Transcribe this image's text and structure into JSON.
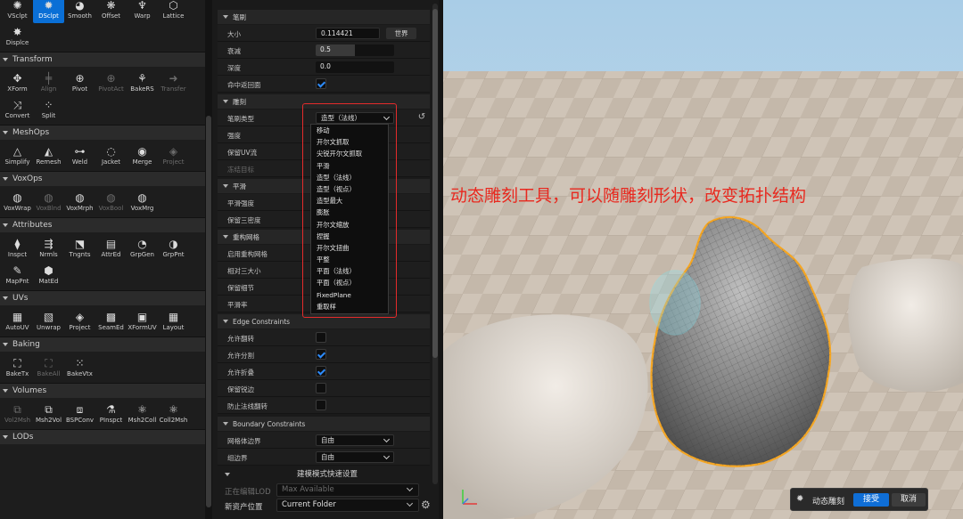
{
  "palette": {
    "sculpt_tools": [
      {
        "label": "VSclpt",
        "icon": "vertex-sculpt-icon"
      },
      {
        "label": "DSclpt",
        "icon": "dynamic-sculpt-icon",
        "active": true
      },
      {
        "label": "Smooth",
        "icon": "smooth-icon"
      },
      {
        "label": "Offset",
        "icon": "offset-icon"
      },
      {
        "label": "Warp",
        "icon": "warp-icon"
      },
      {
        "label": "Lattice",
        "icon": "lattice-icon"
      },
      {
        "label": "Displce",
        "icon": "displace-icon"
      }
    ],
    "categories": [
      {
        "name": "Transform",
        "tools": [
          {
            "label": "XForm"
          },
          {
            "label": "Align",
            "dim": true
          },
          {
            "label": "Pivot"
          },
          {
            "label": "PivotAct",
            "dim": true
          },
          {
            "label": "BakeRS"
          },
          {
            "label": "Transfer",
            "dim": true
          },
          {
            "label": "Convert"
          },
          {
            "label": "Split"
          }
        ]
      },
      {
        "name": "MeshOps",
        "tools": [
          {
            "label": "Simplify"
          },
          {
            "label": "Remesh"
          },
          {
            "label": "Weld"
          },
          {
            "label": "Jacket"
          },
          {
            "label": "Merge"
          },
          {
            "label": "Project",
            "dim": true
          }
        ]
      },
      {
        "name": "VoxOps",
        "tools": [
          {
            "label": "VoxWrap"
          },
          {
            "label": "VoxBlnd",
            "dim": true
          },
          {
            "label": "VoxMrph"
          },
          {
            "label": "VoxBool",
            "dim": true
          },
          {
            "label": "VoxMrg"
          }
        ]
      },
      {
        "name": "Attributes",
        "tools": [
          {
            "label": "Inspct"
          },
          {
            "label": "Nrmls"
          },
          {
            "label": "Tngnts"
          },
          {
            "label": "AttrEd"
          },
          {
            "label": "GrpGen"
          },
          {
            "label": "GrpPnt"
          },
          {
            "label": "MapPnt"
          },
          {
            "label": "MatEd"
          }
        ]
      },
      {
        "name": "UVs",
        "tools": [
          {
            "label": "AutoUV"
          },
          {
            "label": "Unwrap"
          },
          {
            "label": "Project"
          },
          {
            "label": "SeamEd"
          },
          {
            "label": "XFormUV"
          },
          {
            "label": "Layout"
          }
        ]
      },
      {
        "name": "Baking",
        "tools": [
          {
            "label": "BakeTx"
          },
          {
            "label": "BakeAll",
            "dim": true
          },
          {
            "label": "BakeVtx"
          }
        ]
      },
      {
        "name": "Volumes",
        "tools": [
          {
            "label": "Vol2Msh",
            "dim": true
          },
          {
            "label": "Msh2Vol"
          },
          {
            "label": "BSPConv"
          },
          {
            "label": "PInspct"
          },
          {
            "label": "Msh2Coll"
          },
          {
            "label": "Coll2Msh"
          }
        ]
      },
      {
        "name": "LODs",
        "tools": []
      }
    ]
  },
  "panel": {
    "brush_section": "笔刷",
    "size_label": "大小",
    "size_value": "0.114421",
    "world_button": "世界",
    "falloff_label": "衰减",
    "falloff_value": "0.5",
    "falloff_fraction": 0.5,
    "depth_label": "深度",
    "depth_value": "0.0",
    "hit_back_label": "命中返回面",
    "sculpt_section": "雕刻",
    "brush_type_label": "笔刷类型",
    "brush_type_value": "造型（法线）",
    "strength_label": "强度",
    "keep_uv_label": "保留UV流",
    "freeze_label": "冻结目标",
    "smooth_section": "平滑",
    "smooth_strength_label": "平滑强度",
    "keep_density_label": "保留三密度",
    "remesh_section": "重构网格",
    "enable_remesh_label": "启用重构网格",
    "relative_size_label": "相对三大小",
    "keep_detail_label": "保留细节",
    "smooth_rate_label": "平滑率",
    "edge_section": "Edge Constraints",
    "allow_flip_label": "允许翻转",
    "allow_split_label": "允许分割",
    "allow_collapse_label": "允许折叠",
    "keep_sharp_label": "保留锐边",
    "prevent_normal_flip_label": "防止法线翻转",
    "boundary_section": "Boundary Constraints",
    "mesh_boundary_label": "网格体边界",
    "mesh_boundary_value": "自由",
    "group_boundary_label": "组边界",
    "group_boundary_value": "自由",
    "quick_settings": "建模模式快速设置",
    "lod_label": "正在编辑LOD",
    "lod_value": "Max Available",
    "asset_location_label": "新资产位置",
    "asset_location_value": "Current Folder"
  },
  "brush_type_options": [
    "移动",
    "开尔文抓取",
    "尖锐开尔文抓取",
    "平滑",
    "造型（法线）",
    "造型（视点）",
    "造型最大",
    "膨胀",
    "开尔文缩放",
    "捏握",
    "开尔文扭曲",
    "平整",
    "平面（法线）",
    "平面（视点）",
    "FixedPlane",
    "重取样"
  ],
  "viewport": {
    "annotation": "动态雕刻工具，可以随雕刻形状，改变拓扑结构",
    "tool_name": "动态雕刻",
    "accept_label": "接受",
    "cancel_label": "取消",
    "accent": "#0f6ed6",
    "annotation_color": "#e8291f",
    "selection_outline": "#f5a623"
  }
}
